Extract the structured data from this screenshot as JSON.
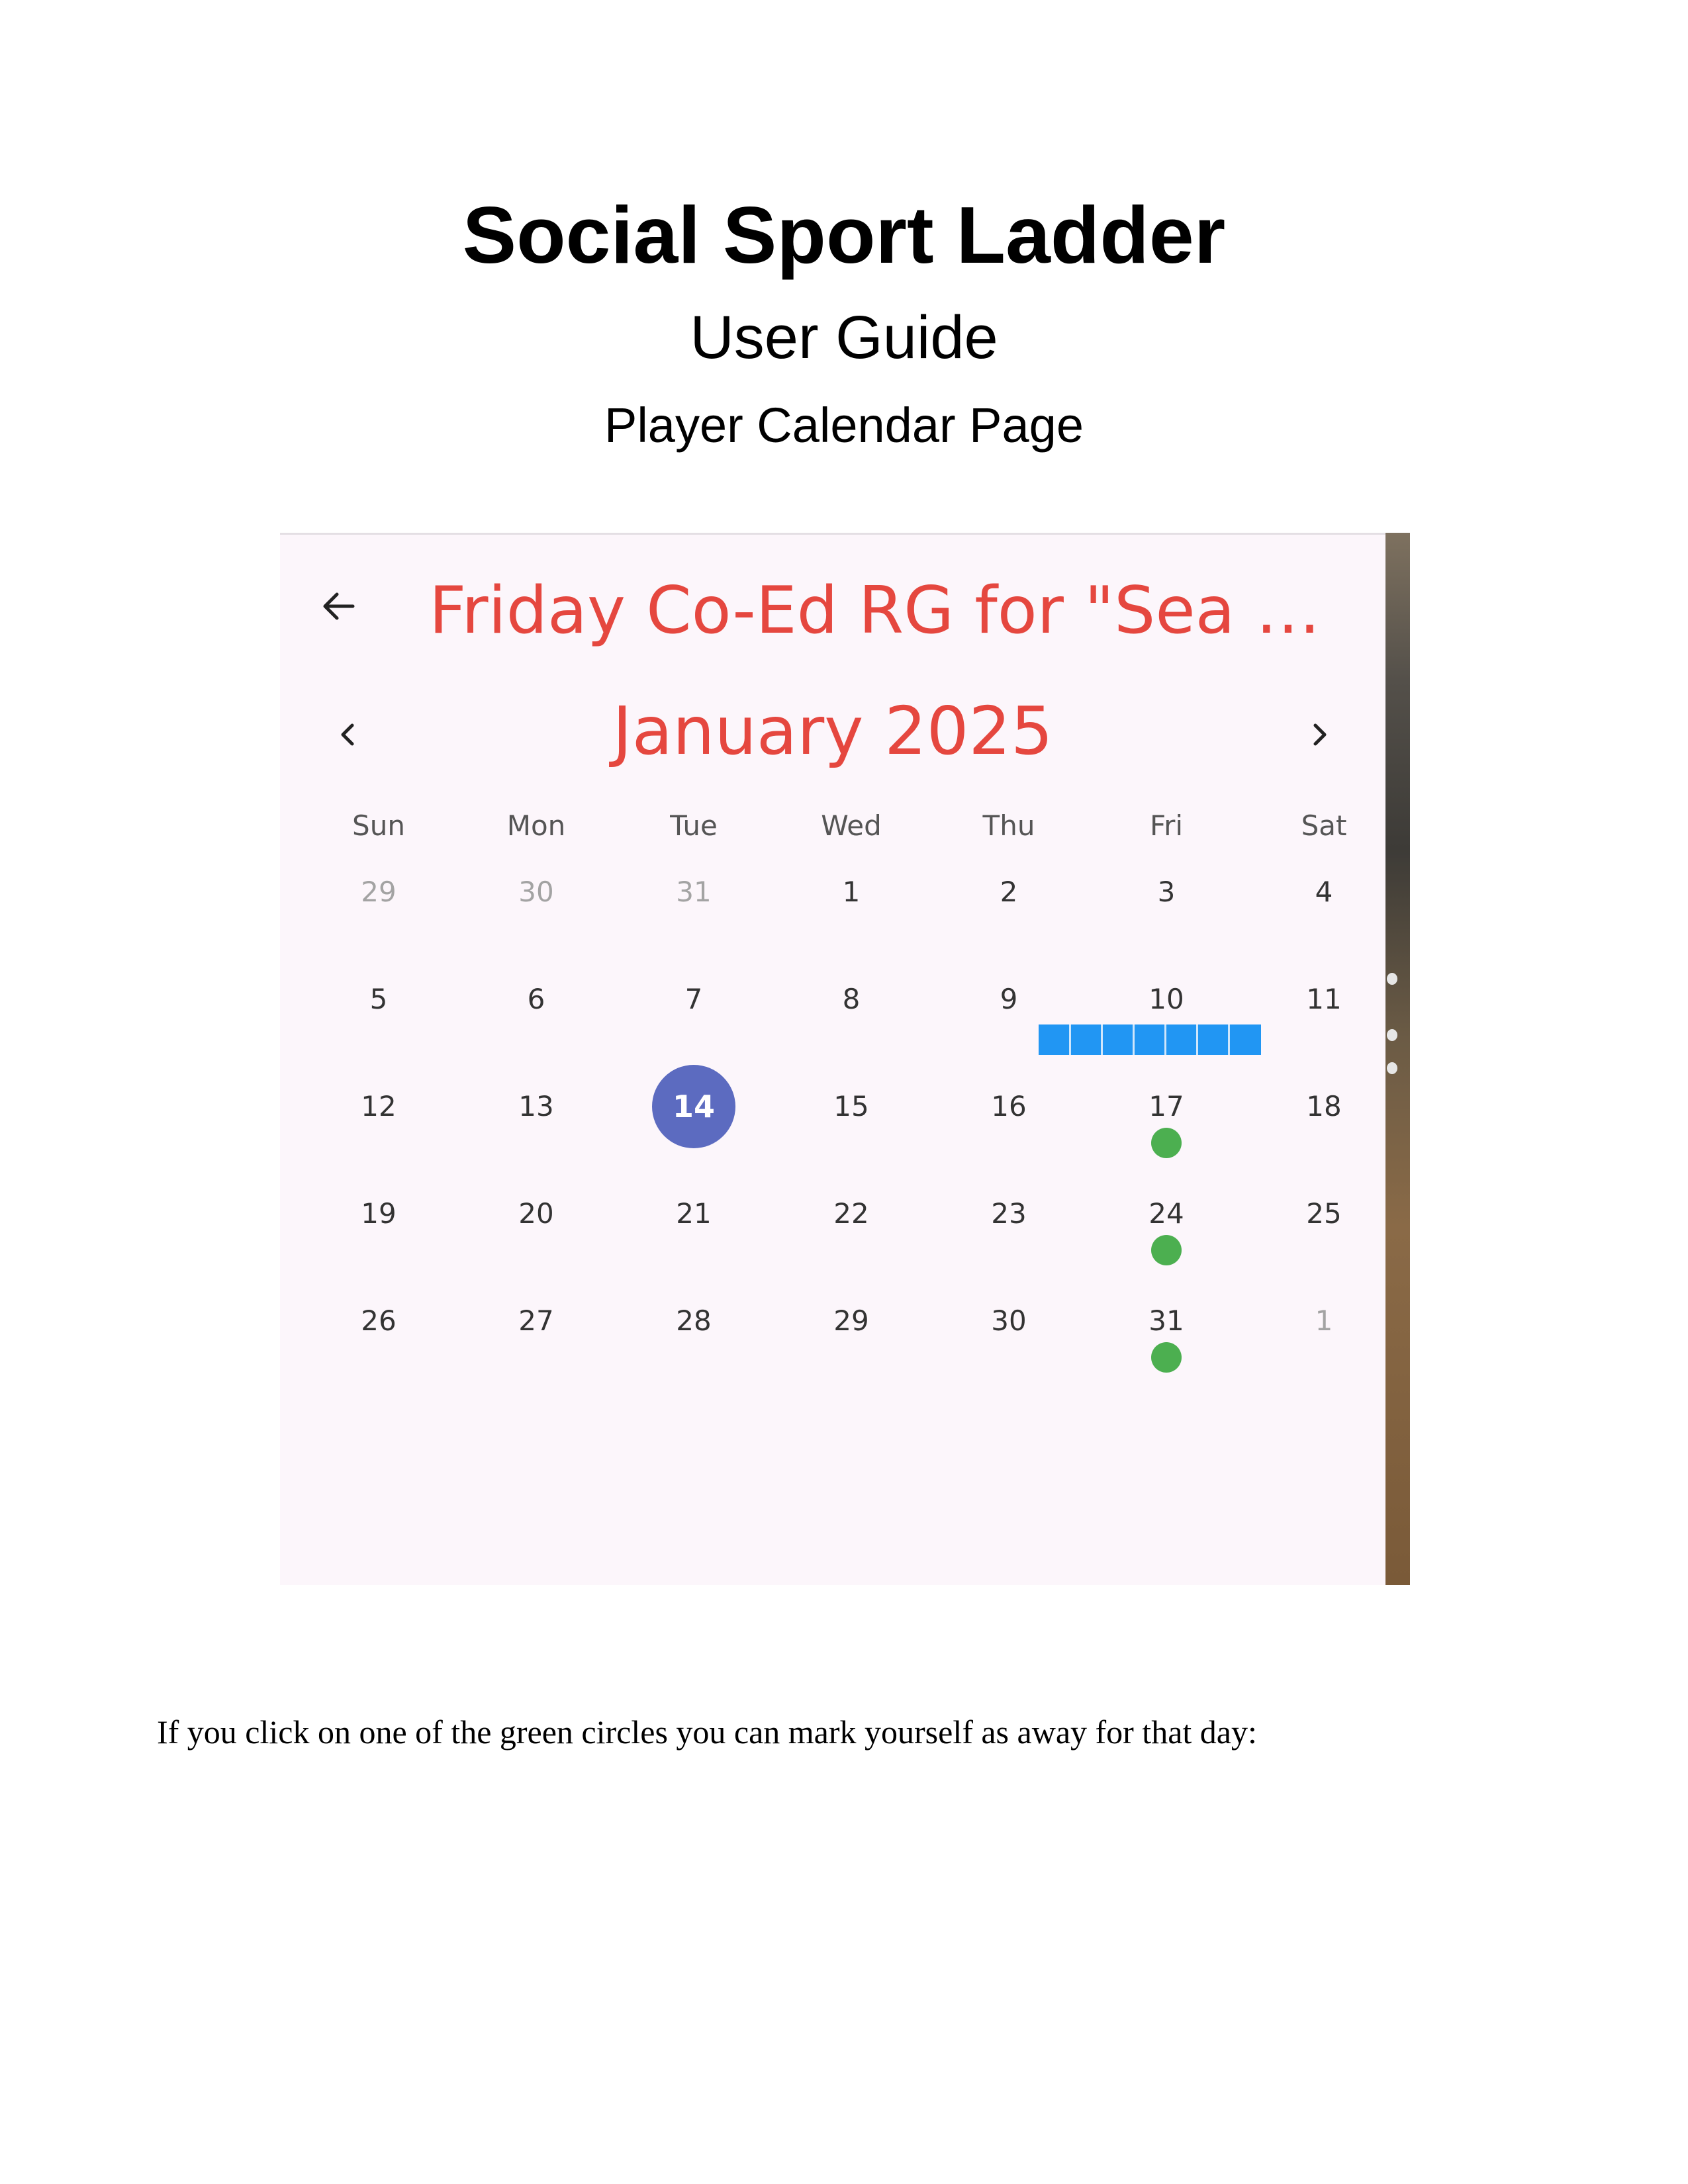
{
  "document": {
    "title": "Social Sport Ladder",
    "subtitle": "User Guide",
    "section": "Player Calendar Page",
    "body_text": "If you click on one of the green circles you can mark yourself as away for that day:"
  },
  "app": {
    "back_icon": "arrow-left-icon",
    "title": "Friday Co-Ed RG for \"Sea …",
    "month_label": "January 2025",
    "prev_icon": "chevron-left-icon",
    "next_icon": "chevron-right-icon",
    "title_color": "#e5473f",
    "today_color": "#5c6bc0",
    "event_dot_color": "#4caf50",
    "event_bar_color": "#2196f3",
    "weekdays": [
      "Sun",
      "Mon",
      "Tue",
      "Wed",
      "Thu",
      "Fri",
      "Sat"
    ],
    "weeks": [
      [
        {
          "d": "29",
          "outside": true
        },
        {
          "d": "30",
          "outside": true
        },
        {
          "d": "31",
          "outside": true
        },
        {
          "d": "1"
        },
        {
          "d": "2"
        },
        {
          "d": "3"
        },
        {
          "d": "4"
        }
      ],
      [
        {
          "d": "5"
        },
        {
          "d": "6"
        },
        {
          "d": "7"
        },
        {
          "d": "8"
        },
        {
          "d": "9"
        },
        {
          "d": "10",
          "bar": true
        },
        {
          "d": "11"
        }
      ],
      [
        {
          "d": "12"
        },
        {
          "d": "13"
        },
        {
          "d": "14",
          "today": true
        },
        {
          "d": "15"
        },
        {
          "d": "16"
        },
        {
          "d": "17",
          "dot": true
        },
        {
          "d": "18"
        }
      ],
      [
        {
          "d": "19"
        },
        {
          "d": "20"
        },
        {
          "d": "21"
        },
        {
          "d": "22"
        },
        {
          "d": "23"
        },
        {
          "d": "24",
          "dot": true
        },
        {
          "d": "25"
        }
      ],
      [
        {
          "d": "26"
        },
        {
          "d": "27"
        },
        {
          "d": "28"
        },
        {
          "d": "29"
        },
        {
          "d": "30"
        },
        {
          "d": "31",
          "dot": true
        },
        {
          "d": "1",
          "outside": true
        }
      ]
    ]
  }
}
